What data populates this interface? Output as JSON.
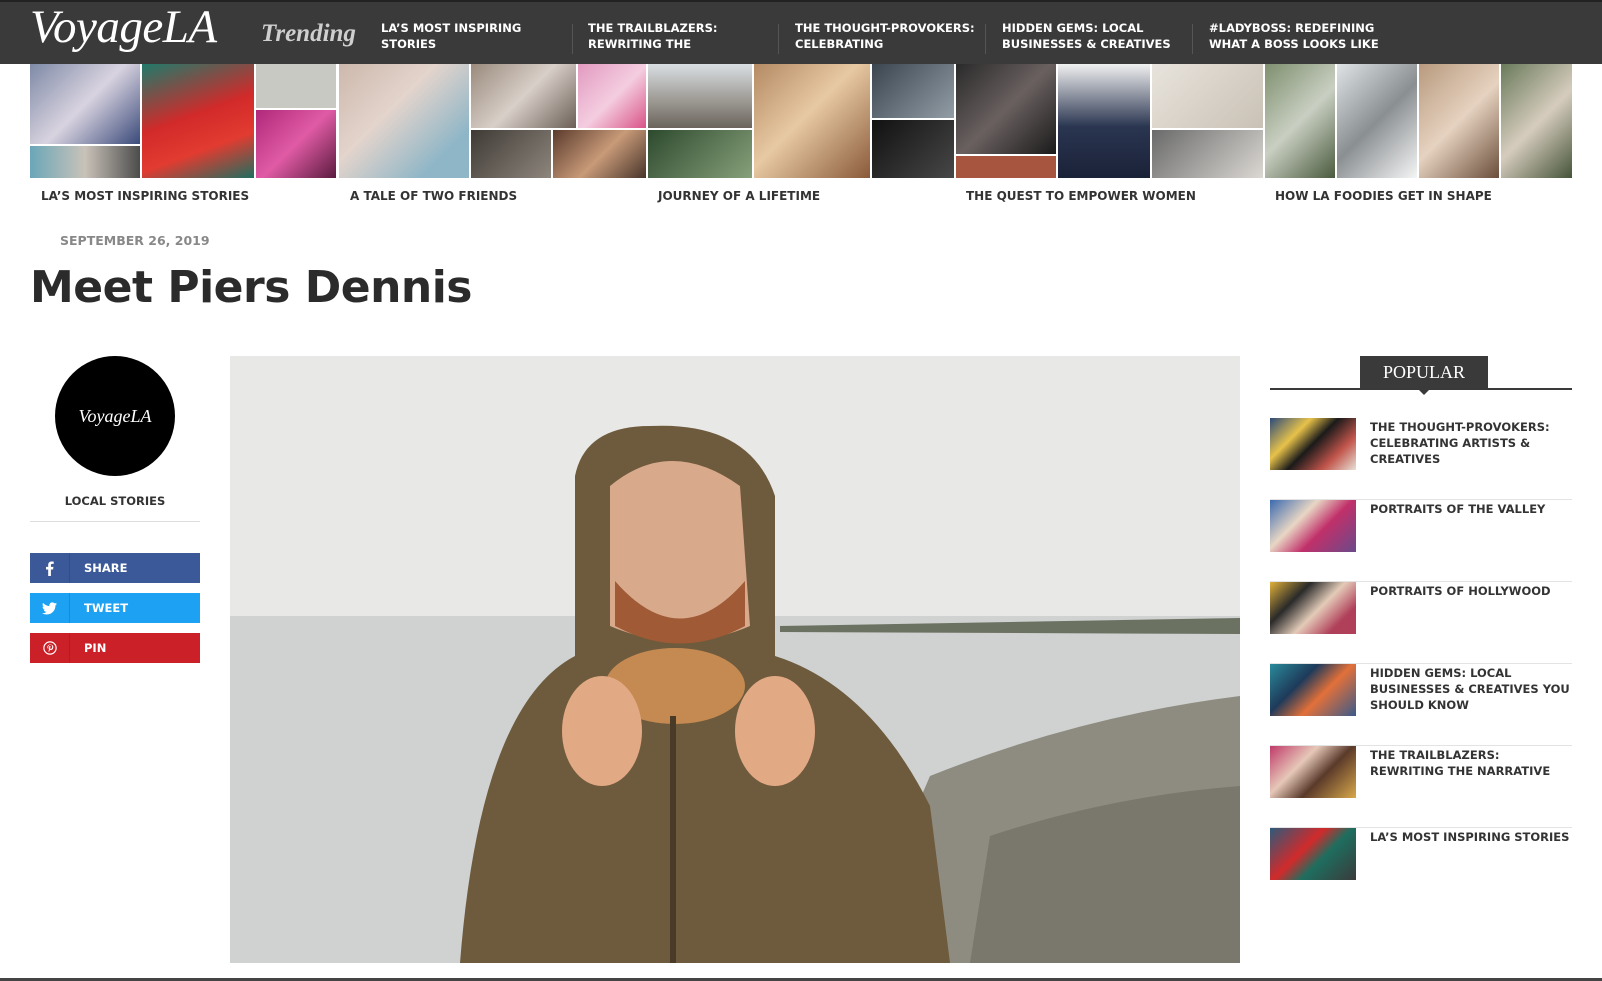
{
  "header": {
    "logo": "VoyageLA",
    "trending_label": "Trending",
    "nav": [
      {
        "label": "LA’S MOST INSPIRING STORIES"
      },
      {
        "label": "THE TRAILBLAZERS: REWRITING THE"
      },
      {
        "label": "THE THOUGHT-PROVOKERS: CELEBRATING"
      },
      {
        "label": "HIDDEN GEMS: LOCAL BUSINESSES & CREATIVES"
      },
      {
        "label": "#LADYBOSS: REDEFINING WHAT A BOSS LOOKS LIKE"
      }
    ]
  },
  "strip": {
    "captions": [
      "LA’S MOST INSPIRING STORIES",
      "A TALE OF TWO FRIENDS",
      "JOURNEY OF A LIFETIME",
      "THE QUEST TO EMPOWER WOMEN",
      "HOW LA FOODIES GET IN SHAPE"
    ]
  },
  "article": {
    "date": "SEPTEMBER 26, 2019",
    "title": "Meet Piers Dennis"
  },
  "author": {
    "avatar_text": "VoyageLA",
    "section": "LOCAL STORIES"
  },
  "share": {
    "facebook": "SHARE",
    "twitter": "TWEET",
    "pinterest": "PIN"
  },
  "popular": {
    "heading": "POPULAR",
    "items": [
      {
        "title": "THE THOUGHT-PROVOKERS: CELEBRATING ARTISTS & CREATIVES"
      },
      {
        "title": "PORTRAITS OF THE VALLEY"
      },
      {
        "title": "PORTRAITS OF HOLLYWOOD"
      },
      {
        "title": "HIDDEN GEMS: LOCAL BUSINESSES & CREATIVES YOU SHOULD KNOW"
      },
      {
        "title": "THE TRAILBLAZERS: REWRITING THE NARRATIVE"
      },
      {
        "title": "LA’S MOST INSPIRING STORIES"
      }
    ]
  },
  "colors": {
    "topbar": "#3a3a3a",
    "facebook": "#3b5998",
    "twitter": "#1da1f2",
    "pinterest": "#cb2027"
  },
  "icons": [
    "facebook-icon",
    "twitter-icon",
    "pinterest-icon"
  ]
}
